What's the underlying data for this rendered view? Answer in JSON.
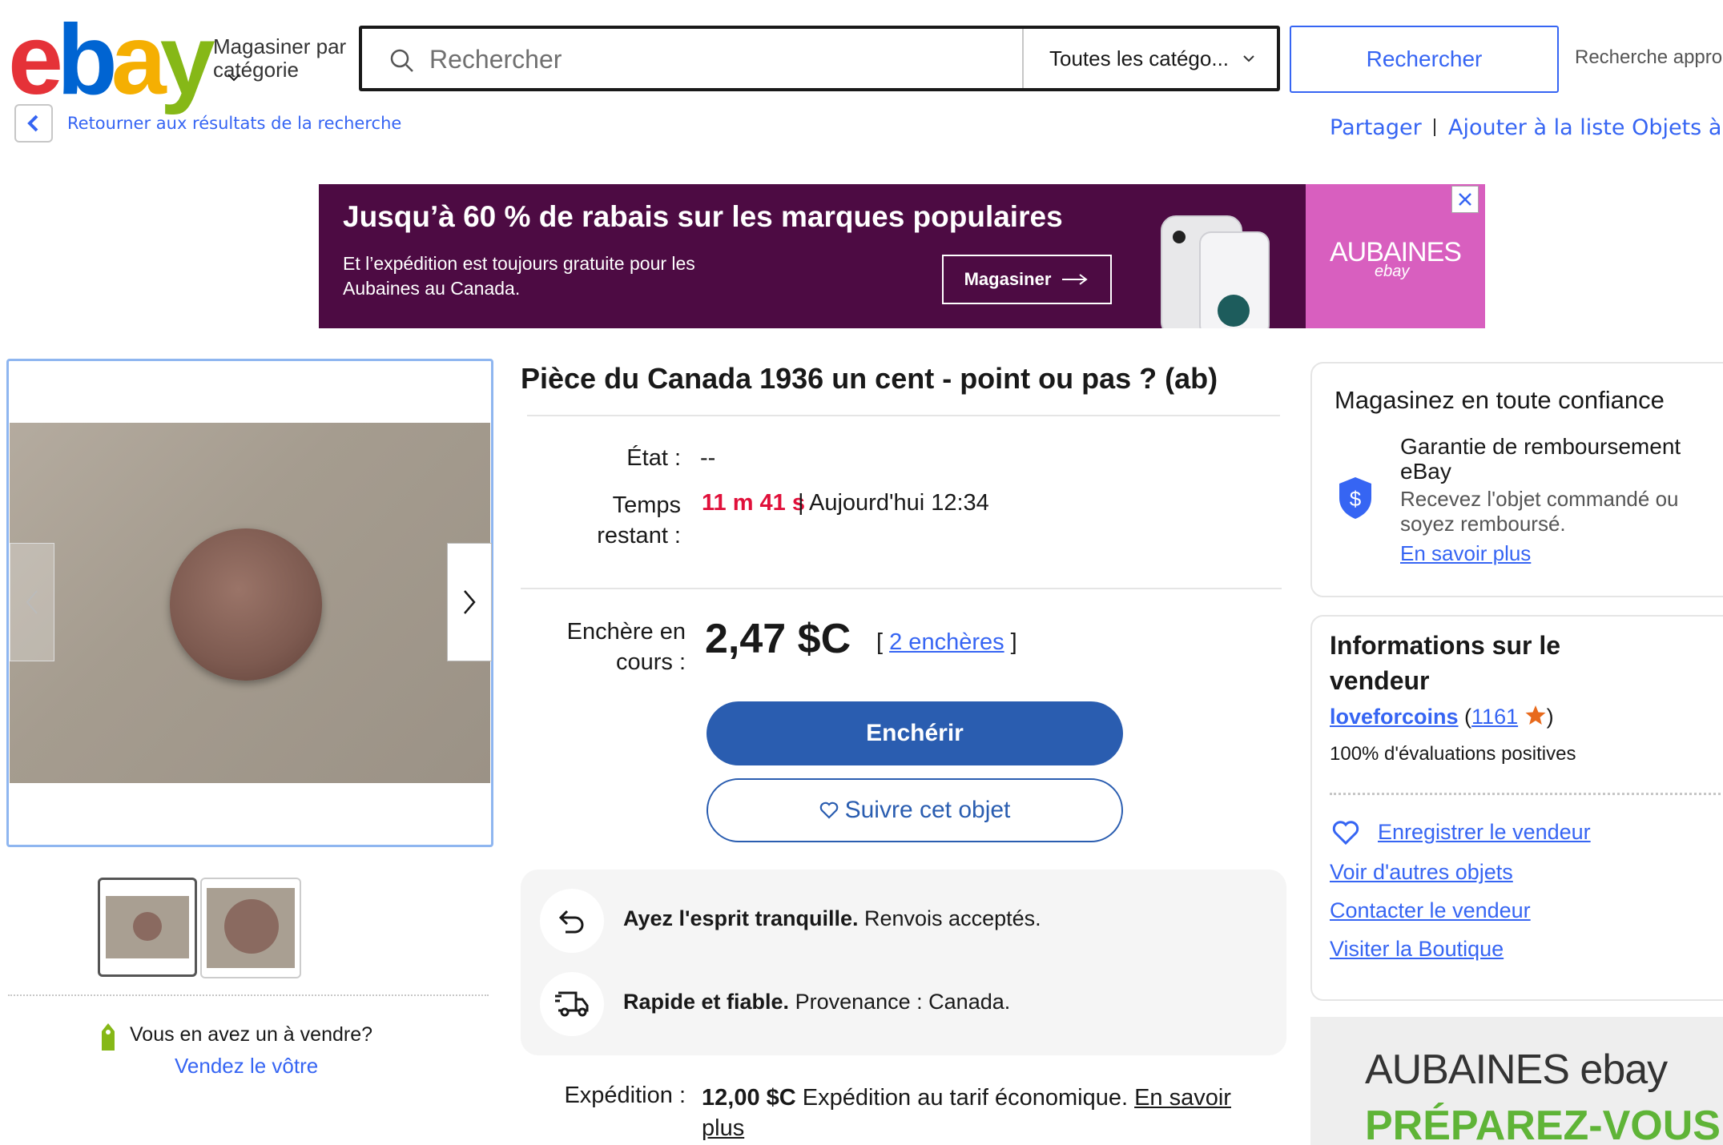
{
  "header": {
    "logo": "ebay",
    "shop_by_category": "Magasiner par catégorie",
    "search_placeholder": "Rechercher",
    "category_select": "Toutes les catégo...",
    "search_button": "Rechercher",
    "advanced_search": "Recherche appro",
    "back_link": "Retourner aux résultats de la recherche",
    "share": "Partager",
    "add_to_watchlist": "Ajouter à la liste Objets à"
  },
  "banner": {
    "title": "Jusqu’à 60 % de rabais sur les marques populaires",
    "subtitle": "Et l’expédition est toujours gratuite pour les Aubaines au Canada.",
    "button": "Magasiner",
    "brand": "AUBAINES",
    "brand_sub": "ebay"
  },
  "listing": {
    "title": "Pièce du Canada 1936 un cent - point ou pas ? (ab)",
    "condition_label": "État :",
    "condition_value": "--",
    "time_label": "Temps restant :",
    "time_left": "11 m 41 s",
    "time_end": "| Aujourd'hui 12:34",
    "current_bid_label": "Enchère en cours :",
    "price": "2,47 $C",
    "bids_count": "2 enchères",
    "bid_button": "Enchérir",
    "watch_button": "Suivre cet objet",
    "assurance1_bold": "Ayez l'esprit tranquille.",
    "assurance1_text": " Renvois acceptés.",
    "assurance2_bold": "Rapide et fiable.",
    "assurance2_text": " Provenance : Canada.",
    "shipping_label": "Expédition :",
    "shipping_price": "12,00 $C",
    "shipping_text": " Expédition au tarif économique. ",
    "shipping_link": "En savoir plus"
  },
  "gallery": {
    "sell_question": "Vous en avez un à vendre?",
    "sell_link": "Vendez le vôtre"
  },
  "confidence": {
    "title": "Magasinez en toute confiance",
    "guarantee_title": "Garantie de remboursement eBay",
    "guarantee_desc": "Recevez l'objet commandé ou soyez remboursé.",
    "learn_more": "En savoir plus"
  },
  "seller": {
    "title": "Informations sur le vendeur",
    "name": "loveforcoins",
    "feedback_score": "1161",
    "positive": "100% d'évaluations positives",
    "save_seller": "Enregistrer le vendeur",
    "other_items": "Voir d'autres objets",
    "contact": "Contacter le vendeur",
    "store": "Visiter la Boutique"
  },
  "side_ad": {
    "brand": "AUBAINES ebay",
    "sub": "PRÉPAREZ-VOUS À"
  },
  "colors": {
    "ebay_red": "#e53238",
    "ebay_blue": "#0064d2",
    "ebay_yellow": "#f5af02",
    "ebay_green": "#86b817",
    "link": "#3665f3",
    "bid_button": "#2a5db0",
    "time_red": "#e0103a"
  }
}
